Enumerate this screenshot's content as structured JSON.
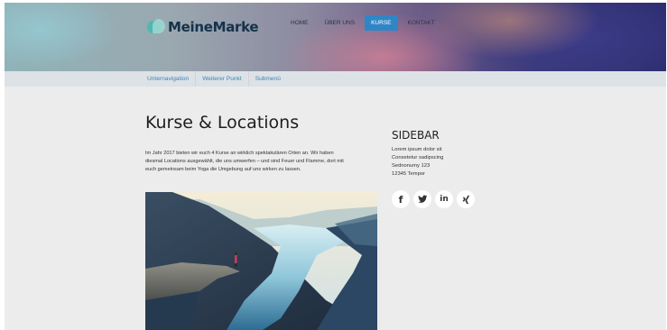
{
  "brand": {
    "name": "MeineMarke"
  },
  "main_nav": [
    {
      "label": "HOME",
      "active": false
    },
    {
      "label": "ÜBER UNS",
      "active": false
    },
    {
      "label": "KURSE",
      "active": true
    },
    {
      "label": "KONTAKT",
      "active": false
    }
  ],
  "sub_nav": [
    {
      "label": "Unternavigation"
    },
    {
      "label": "Weiterer Punkt"
    },
    {
      "label": "Submenü"
    }
  ],
  "content": {
    "title": "Kurse & Locations",
    "intro_lines": [
      "Im Jahr 2017 bieten wir euch 4 Kurse an wirklich spektakulären Orten an. Wir haben",
      "diesmal Locations ausgewählt, die uns umwerfen – und sind Feuer und Flamme, dort mit",
      "euch gemeinsam beim Yoga die Umgebung auf uns wirken zu lassen."
    ]
  },
  "sidebar": {
    "title": "SIDEBAR",
    "address_lines": [
      "Lorem ipsum dolor sit",
      "Consetetur sadipscing",
      "Sednonumy 123",
      "12345 Tempor"
    ],
    "social": [
      {
        "icon": "facebook-icon",
        "glyph": "f"
      },
      {
        "icon": "twitter-icon",
        "glyph": ""
      },
      {
        "icon": "linkedin-icon",
        "glyph": "in"
      },
      {
        "icon": "xing-icon",
        "glyph": ""
      }
    ]
  },
  "colors": {
    "accent": "#2f86c6",
    "subnav_link": "#3a86b8",
    "page_bg": "#ececec",
    "subnav_bg": "#dde2e6"
  }
}
